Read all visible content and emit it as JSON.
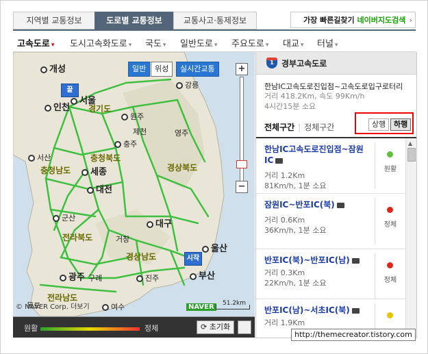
{
  "top_tabs": [
    "지역별 교통정보",
    "도로별 교통정보",
    "교통사고·통제정보"
  ],
  "top_link": {
    "text": "가장 빠른길찾기 ",
    "brand": "네이버지도검색",
    "arrow": "›"
  },
  "road_menu": [
    "고속도로",
    "도시고속화도로",
    "국도",
    "일반도로",
    "주요도로",
    "대교",
    "터널"
  ],
  "map": {
    "buttons": {
      "normal": "일반",
      "satellite": "위성",
      "realtime": "실시간교통"
    },
    "pins": {
      "end": "끝",
      "start": "시작"
    },
    "places": {
      "gaeseong": "개성",
      "incheon": "인천",
      "seoul": "서울",
      "gyeonggi": "경기도",
      "gangneung": "강릉",
      "wonju": "원주",
      "jecheon": "제천",
      "chungju": "충주",
      "seosan": "서산",
      "chungbuk": "충청북도",
      "chungnam": "충청남도",
      "sejong": "세종",
      "gyeongbuk": "경상북도",
      "daejeon": "대전",
      "gunsan": "군산",
      "daegu": "대구",
      "jeonbuk": "전라북도",
      "ulsan": "울산",
      "gyeongnam": "경상남도",
      "gwangju": "광주",
      "busan": "부산",
      "jeonnam": "전라남도",
      "yeosu": "여수",
      "mokpo": "목포",
      "gurye": "구례",
      "jinju": "진주",
      "geochang": "거창",
      "yeongju": "영주"
    },
    "copyright": "© NAVER Corp.  더보기",
    "brand": "NAVER",
    "scale": "51.2km"
  },
  "legend": {
    "smooth": "원활",
    "congested": "정체",
    "reset": "초기화"
  },
  "panel": {
    "shield_number": "1",
    "title": "경부고속도로",
    "route": "한남IC고속도로진입점~고속도로입구로터리",
    "info": "거리 418.2Km, 속도 99Km/h",
    "time": "4시간15분 소요",
    "tab_all": "전체구간",
    "tab_congested": "정체구간",
    "dir_up": "상행",
    "dir_down": "하행"
  },
  "segments": [
    {
      "name": "한남IC고속도로진입점~잠원IC",
      "distance": "거리 1.2Km",
      "speed": "81Km/h, 1분 소요",
      "status": "원활",
      "color": "#5cc23a"
    },
    {
      "name": "잠원IC~반포IC(북)",
      "distance": "거리 0.6Km",
      "speed": "36Km/h, 1분 소요",
      "status": "정체",
      "color": "#e0251b"
    },
    {
      "name": "반포IC(북)~반포IC(남)",
      "distance": "거리 0.3Km",
      "speed": "22Km/h, 1분 소요",
      "status": "정체",
      "color": "#e0251b"
    },
    {
      "name": "반포IC(남)~서초IC(북)",
      "distance": "거리 1.9Km",
      "speed": "",
      "status": "",
      "color": "#e8c400"
    }
  ],
  "url": "http://themecreator.tistory.com"
}
